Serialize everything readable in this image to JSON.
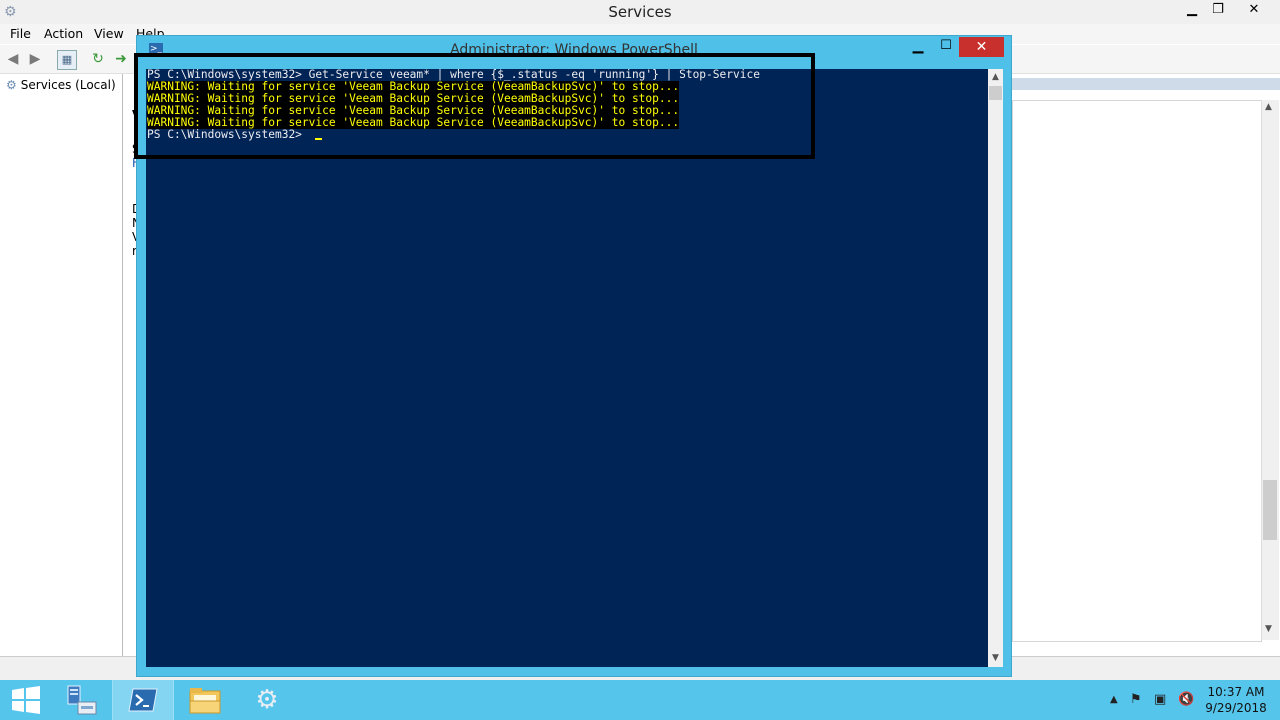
{
  "services_window": {
    "title": "Services",
    "menu": [
      "File",
      "Action",
      "View",
      "Help"
    ],
    "tree_item": "Services (Local)",
    "mid_pane_text": [
      "V",
      "S",
      "F",
      "D",
      "N",
      "V",
      "r"
    ]
  },
  "powershell": {
    "title": "Administrator: Windows PowerShell",
    "lines": [
      {
        "text": "PS C:\\Windows\\system32> Get-Service veeam* | where {$_.status -eq 'running'} | Stop-Service",
        "kind": "normal"
      },
      {
        "text": "WARNING: Waiting for service 'Veeam Backup Service (VeeamBackupSvc)' to stop...",
        "kind": "warn"
      },
      {
        "text": "WARNING: Waiting for service 'Veeam Backup Service (VeeamBackupSvc)' to stop...",
        "kind": "warn"
      },
      {
        "text": "WARNING: Waiting for service 'Veeam Backup Service (VeeamBackupSvc)' to stop...",
        "kind": "warn"
      },
      {
        "text": "WARNING: Waiting for service 'Veeam Backup Service (VeeamBackupSvc)' to stop...",
        "kind": "warn"
      },
      {
        "text": "PS C:\\Windows\\system32> ",
        "kind": "normal"
      }
    ],
    "colors": {
      "console_bg": "#012456",
      "text": "#eeedf0",
      "warning": "#ffff00",
      "close": "#c7302c",
      "frame": "#4fc0e8"
    }
  },
  "taskbar": {
    "apps": [
      {
        "name": "Server Manager",
        "icon": "server-manager-icon",
        "active": false
      },
      {
        "name": "Windows PowerShell",
        "icon": "powershell-icon",
        "active": true
      },
      {
        "name": "File Explorer",
        "icon": "folder-icon",
        "active": false
      },
      {
        "name": "Services",
        "icon": "services-gear-icon",
        "active": false
      }
    ],
    "clock_time": "10:37 AM",
    "clock_date": "9/29/2018",
    "color": "#56c5ec"
  }
}
